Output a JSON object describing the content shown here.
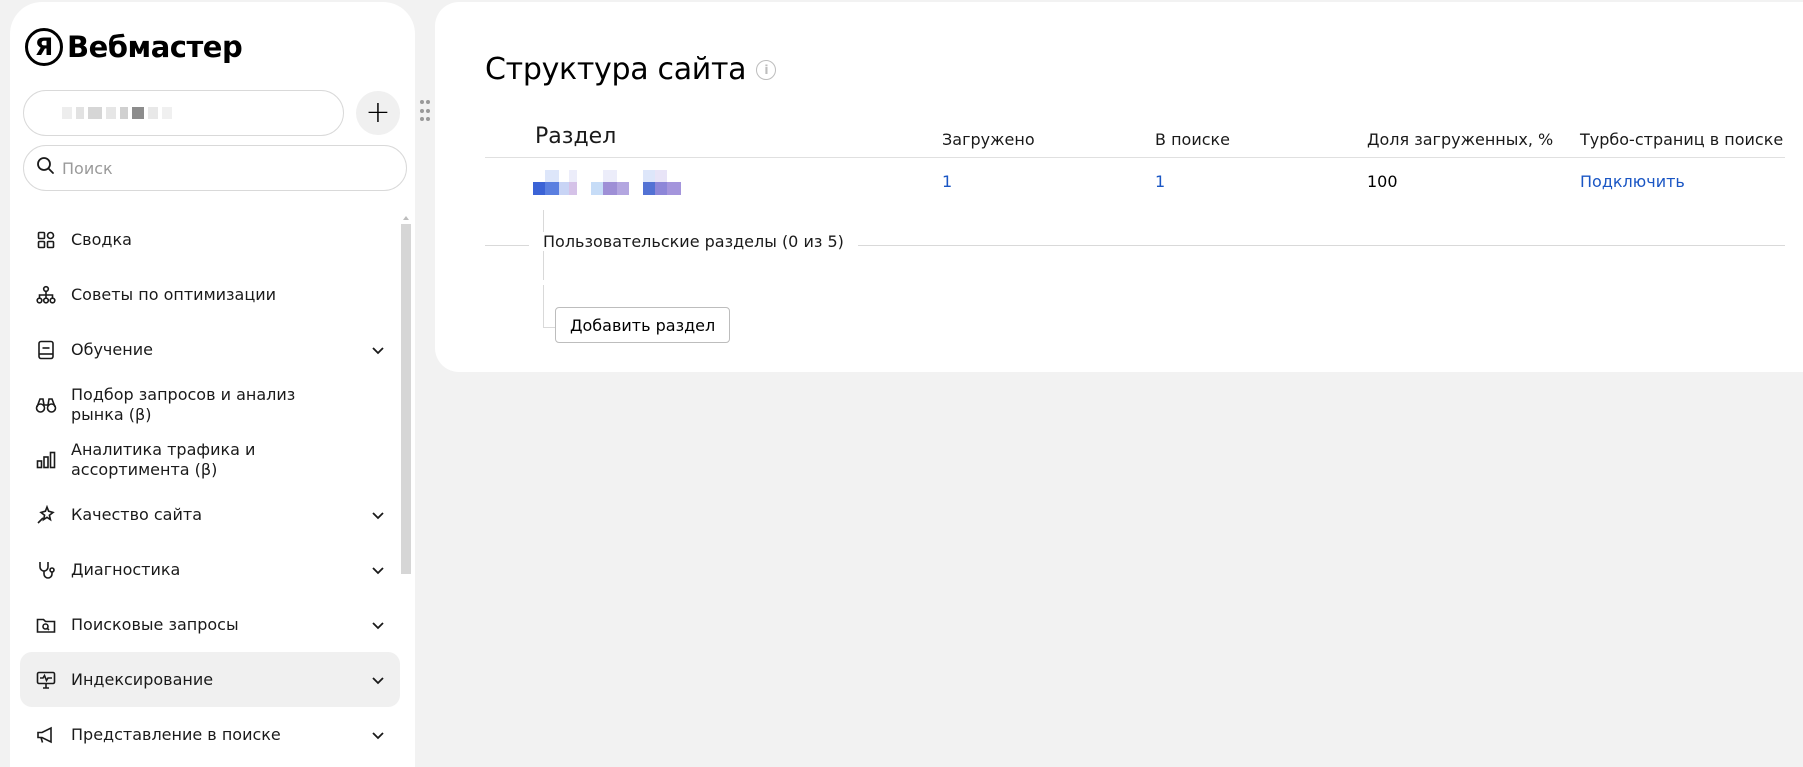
{
  "app": {
    "logo_letter": "Я",
    "title": "Вебмастер"
  },
  "site_selector": {
    "add_label": "+"
  },
  "search": {
    "placeholder": "Поиск"
  },
  "sidebar": {
    "items": [
      {
        "label": "Сводка",
        "icon": "dashboard-grid-icon",
        "has_chevron": false
      },
      {
        "label": "Советы по оптимизации",
        "icon": "hierarchy-icon",
        "has_chevron": false
      },
      {
        "label": "Обучение",
        "icon": "book-icon",
        "has_chevron": true
      },
      {
        "label": "Подбор запросов и анализ рынка (β)",
        "icon": "binoculars-icon",
        "has_chevron": false
      },
      {
        "label": "Аналитика трафика и ассортимента (β)",
        "icon": "bar-chart-icon",
        "has_chevron": false
      },
      {
        "label": "Качество сайта",
        "icon": "sparkle-icon",
        "has_chevron": true
      },
      {
        "label": "Диагностика",
        "icon": "stethoscope-icon",
        "has_chevron": true
      },
      {
        "label": "Поисковые запросы",
        "icon": "search-folder-icon",
        "has_chevron": true
      },
      {
        "label": "Индексирование",
        "icon": "monitor-pulse-icon",
        "has_chevron": true,
        "active": true
      },
      {
        "label": "Представление в поиске",
        "icon": "megaphone-icon",
        "has_chevron": true
      }
    ]
  },
  "main": {
    "title": "Структура сайта",
    "info_icon": "i",
    "table": {
      "headers": [
        "Раздел",
        "Загружено",
        "В поиске",
        "Доля загруженных, %",
        "Турбо-страниц в поиске"
      ],
      "rows": [
        {
          "loaded": "1",
          "in_search": "1",
          "share": "100",
          "turbo": "Подключить"
        }
      ]
    },
    "user_sections_label": "Пользовательские разделы (0 из 5)",
    "add_section_label": "Добавить раздел"
  },
  "colors": {
    "link": "#1a56c4",
    "active_bg": "#f0f0f0",
    "page_bg": "#f2f2f2"
  }
}
